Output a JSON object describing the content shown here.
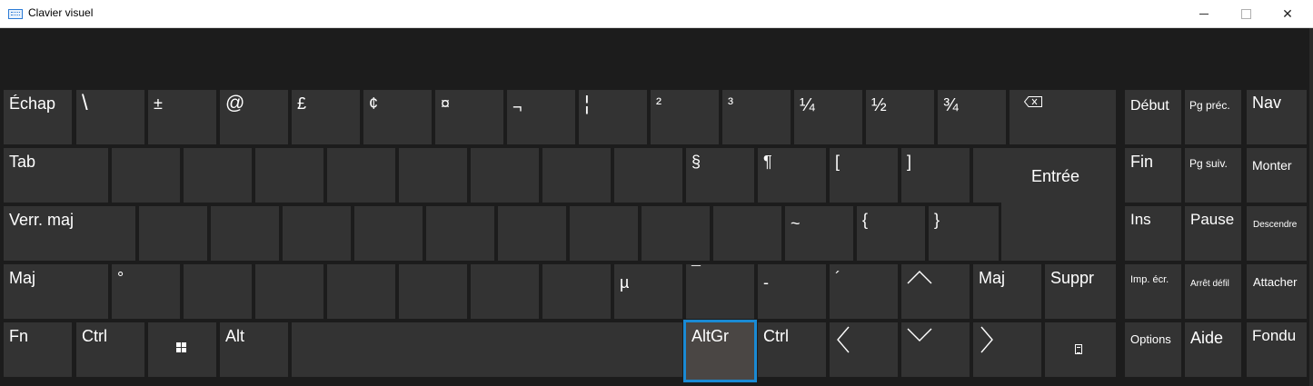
{
  "window": {
    "title": "Clavier visuel",
    "icon": "keyboard-icon",
    "controls": [
      "minimize-icon",
      "maximize-icon",
      "close-icon"
    ]
  },
  "keys": {
    "esc": "Échap",
    "backslash": "\\",
    "plusminus": "±",
    "at": "@",
    "pound": "£",
    "cent": "¢",
    "currency": "¤",
    "not": "¬",
    "brokenbar": "¦",
    "sup2": "²",
    "sup3": "³",
    "quarter": "¼",
    "half": "½",
    "threequarters": "¾",
    "backspace": "backspace-icon",
    "tab": "Tab",
    "section": "§",
    "pilcrow": "¶",
    "lbracket": "[",
    "rbracket": "]",
    "enter": "Entrée",
    "capslock": "Verr. maj",
    "tilde": "~",
    "lbrace": "{",
    "rbrace": "}",
    "shift_left": "Maj",
    "degree": "°",
    "mu": "µ",
    "macron": "¯",
    "hyphen": "-",
    "acute": "´",
    "shift_right": "Maj",
    "delete": "Suppr",
    "fn": "Fn",
    "ctrl_left": "Ctrl",
    "windows": "windows-icon",
    "alt": "Alt",
    "altgr": "AltGr",
    "ctrl_right": "Ctrl",
    "menu": "menu-icon",
    "home": "Début",
    "pgup": "Pg préc.",
    "nav": "Nav",
    "end": "Fin",
    "pgdn": "Pg suiv.",
    "moveup": "Monter",
    "insert": "Ins",
    "pause": "Pause",
    "movedown": "Descendre",
    "prtscn": "Imp. écr.",
    "scrolllock": "Arrêt défil",
    "dock": "Attacher",
    "options": "Options",
    "help": "Aide",
    "fade": "Fondu"
  },
  "state": {
    "selected_key": "AltGr",
    "accent_color": "#1a8ad4",
    "key_color": "#333333",
    "background_color": "#1c1c1c"
  }
}
